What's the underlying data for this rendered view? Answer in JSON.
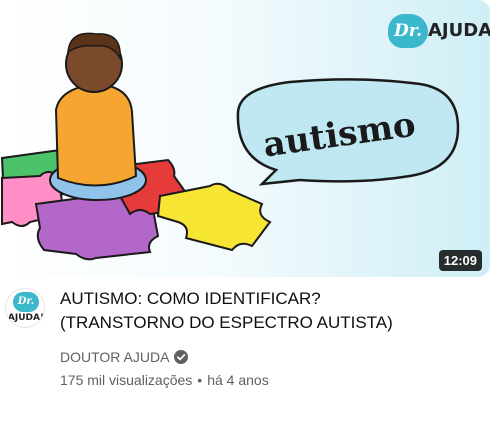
{
  "video": {
    "thumbnail": {
      "bubble_text": "autismo",
      "logo_dr": "Dr.",
      "logo_ajuda": "AJUDA!",
      "duration": "12:09"
    },
    "title_line1": "AUTISMO: COMO IDENTIFICAR?",
    "title_line2": "(TRANSTORNO DO ESPECTRO AUTISTA)",
    "channel_name": "DOUTOR AJUDA",
    "verified_icon": "verified-check-icon",
    "views": "175 mil visualizações",
    "separator": "•",
    "age": "há 4 anos"
  },
  "avatar": {
    "dr": "Dr.",
    "ajuda": "AJUDA!"
  },
  "colors": {
    "accent_teal": "#3cb8cc",
    "bubble_fill": "#bfe8f2",
    "text_primary": "#0f0f0f",
    "text_secondary": "#606060"
  }
}
